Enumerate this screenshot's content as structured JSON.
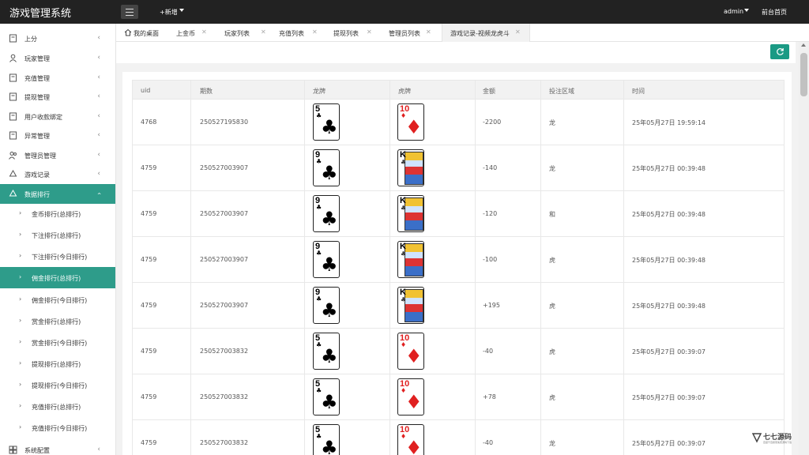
{
  "header": {
    "app_title": "游戏管理系统",
    "new_label": "+新增",
    "user_label": "admin",
    "home_link": "前台首页"
  },
  "sidebar": {
    "items": [
      {
        "label": "上分",
        "icon": "file-icon"
      },
      {
        "label": "玩家管理",
        "icon": "user-icon"
      },
      {
        "label": "充值管理",
        "icon": "file-icon"
      },
      {
        "label": "提现管理",
        "icon": "file-icon"
      },
      {
        "label": "用户收款绑定",
        "icon": "file-icon"
      },
      {
        "label": "异常管理",
        "icon": "file-icon"
      },
      {
        "label": "管理员管理",
        "icon": "users-icon"
      },
      {
        "label": "游戏记录",
        "icon": "recycle-icon"
      },
      {
        "label": "数据排行",
        "icon": "recycle-icon"
      }
    ],
    "sub_items": [
      "金币排行(总排行)",
      "下注排行(总排行)",
      "下注排行(今日排行)",
      "佣金排行(总排行)",
      "佣金排行(今日排行)",
      "赏金排行(总排行)",
      "赏金排行(今日排行)",
      "提现排行(总排行)",
      "提现排行(今日排行)",
      "充值排行(总排行)",
      "充值排行(今日排行)"
    ],
    "bottom_item": {
      "label": "系统配置",
      "icon": "grid-icon"
    }
  },
  "tabs": [
    {
      "label": "我的桌面",
      "icon": "home-icon"
    },
    {
      "label": "上金币"
    },
    {
      "label": "玩家列表"
    },
    {
      "label": "充值列表"
    },
    {
      "label": "提现列表"
    },
    {
      "label": "管理员列表"
    },
    {
      "label": "游戏记录-视频龙虎斗"
    }
  ],
  "table": {
    "columns": [
      "uid",
      "期数",
      "龙牌",
      "虎牌",
      "金额",
      "投注区域",
      "时间"
    ],
    "rows": [
      {
        "uid": "4768",
        "period": "250527195830",
        "dragon": {
          "rank": "5",
          "suit": "♣",
          "color": "black"
        },
        "tiger": {
          "rank": "10",
          "suit": "♦",
          "color": "red"
        },
        "amount": "-2200",
        "area": "龙",
        "time": "25年05月27日 19:59:14"
      },
      {
        "uid": "4759",
        "period": "250527003907",
        "dragon": {
          "rank": "9",
          "suit": "♣",
          "color": "black"
        },
        "tiger": {
          "rank": "K",
          "suit": "♣",
          "color": "face"
        },
        "amount": "-140",
        "area": "龙",
        "time": "25年05月27日 00:39:48"
      },
      {
        "uid": "4759",
        "period": "250527003907",
        "dragon": {
          "rank": "9",
          "suit": "♣",
          "color": "black"
        },
        "tiger": {
          "rank": "K",
          "suit": "♣",
          "color": "face"
        },
        "amount": "-120",
        "area": "和",
        "time": "25年05月27日 00:39:48"
      },
      {
        "uid": "4759",
        "period": "250527003907",
        "dragon": {
          "rank": "9",
          "suit": "♣",
          "color": "black"
        },
        "tiger": {
          "rank": "K",
          "suit": "♣",
          "color": "face"
        },
        "amount": "-100",
        "area": "虎",
        "time": "25年05月27日 00:39:48"
      },
      {
        "uid": "4759",
        "period": "250527003907",
        "dragon": {
          "rank": "9",
          "suit": "♣",
          "color": "black"
        },
        "tiger": {
          "rank": "K",
          "suit": "♣",
          "color": "face"
        },
        "amount": "+195",
        "area": "虎",
        "time": "25年05月27日 00:39:48"
      },
      {
        "uid": "4759",
        "period": "250527003832",
        "dragon": {
          "rank": "5",
          "suit": "♣",
          "color": "black"
        },
        "tiger": {
          "rank": "10",
          "suit": "♦",
          "color": "red"
        },
        "amount": "-40",
        "area": "虎",
        "time": "25年05月27日 00:39:07"
      },
      {
        "uid": "4759",
        "period": "250527003832",
        "dragon": {
          "rank": "5",
          "suit": "♣",
          "color": "black"
        },
        "tiger": {
          "rank": "10",
          "suit": "♦",
          "color": "red"
        },
        "amount": "+78",
        "area": "虎",
        "time": "25年05月27日 00:39:07"
      },
      {
        "uid": "4759",
        "period": "250527003832",
        "dragon": {
          "rank": "5",
          "suit": "♣",
          "color": "black"
        },
        "tiger": {
          "rank": "10",
          "suit": "♦",
          "color": "red"
        },
        "amount": "-40",
        "area": "龙",
        "time": "25年05月27日 00:39:07"
      }
    ]
  },
  "watermark": {
    "title": "七七源码",
    "subtitle": "百度千百搜索免费源码下载"
  },
  "colors": {
    "accent": "#2e9c8a",
    "topbar": "#222222",
    "refresh": "#1a9a84"
  }
}
